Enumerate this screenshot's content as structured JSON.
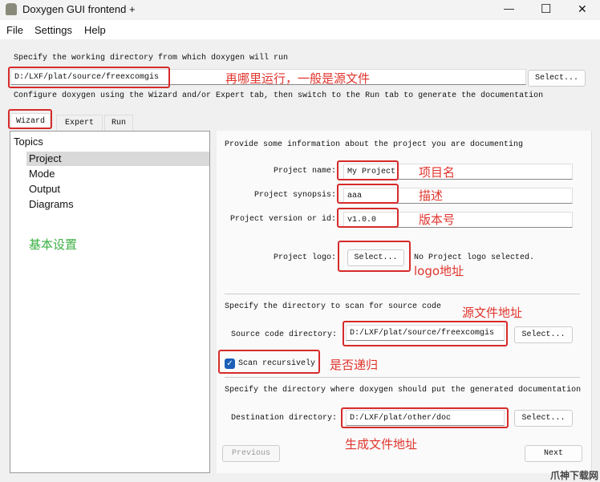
{
  "window": {
    "title": "Doxygen GUI frontend +",
    "minimize": "—",
    "maximize": "☐",
    "close": "✕"
  },
  "menu": [
    "File",
    "Settings",
    "Help"
  ],
  "workdir": {
    "label": "Specify the working directory from which doxygen will run",
    "value": "D:/LXF/plat/source/freexcomgis",
    "select": "Select...",
    "annotation": "再哪里运行，一般是源文件"
  },
  "configure_text": "Configure doxygen using the Wizard and/or Expert tab, then switch to the Run tab to generate the documentation",
  "tabs": [
    {
      "label": "Wizard"
    },
    {
      "label": "Expert"
    },
    {
      "label": "Run"
    }
  ],
  "topics": {
    "header": "Topics",
    "items": [
      "Project",
      "Mode",
      "Output",
      "Diagrams"
    ],
    "selected": "Project",
    "annotation": "基本设置"
  },
  "project": {
    "intro": "Provide some information about the project you are documenting",
    "name_label": "Project name:",
    "name_value": "My Project",
    "name_anno": "项目名",
    "synopsis_label": "Project synopsis:",
    "synopsis_value": "aaa",
    "synopsis_anno": "描述",
    "version_label": "Project version or id:",
    "version_value": "v1.0.0",
    "version_anno": "版本号",
    "logo_label": "Project logo:",
    "logo_select": "Select...",
    "logo_status": "No Project logo selected.",
    "logo_anno": "logo地址",
    "source_intro": "Specify the directory to scan for source code",
    "source_anno": "源文件地址",
    "source_label": "Source code directory:",
    "source_value": "D:/LXF/plat/source/freexcomgis",
    "source_select": "Select...",
    "recursive_label": "Scan recursively",
    "recursive_checked": true,
    "recursive_anno": "是否递归",
    "dest_intro": "Specify the directory where doxygen should put the generated documentation",
    "dest_label": "Destination directory:",
    "dest_value": "D:/LXF/plat/other/doc",
    "dest_select": "Select...",
    "dest_anno": "生成文件地址"
  },
  "nav": {
    "previous": "Previous",
    "next": "Next"
  },
  "watermark": "爪神下载网",
  "colors": {
    "annotation_red": "#e0342c",
    "annotation_green": "#3cb043",
    "check_blue": "#1b5fb8"
  }
}
